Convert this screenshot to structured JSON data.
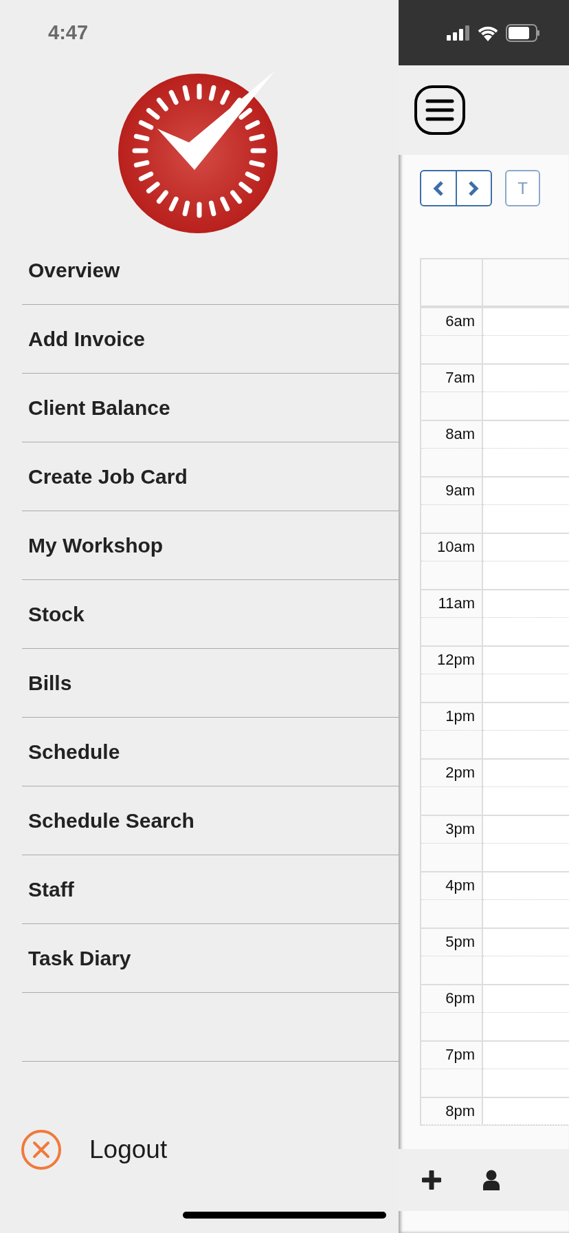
{
  "status_bar": {
    "time": "4:47"
  },
  "menu": {
    "items": [
      {
        "label": "Overview"
      },
      {
        "label": "Add Invoice"
      },
      {
        "label": "Client Balance"
      },
      {
        "label": "Create Job Card"
      },
      {
        "label": "My Workshop"
      },
      {
        "label": "Stock"
      },
      {
        "label": "Bills"
      },
      {
        "label": "Schedule"
      },
      {
        "label": "Schedule Search"
      },
      {
        "label": "Staff"
      },
      {
        "label": "Task Diary"
      }
    ]
  },
  "logout": {
    "label": "Logout"
  },
  "calendar": {
    "today_button": "T",
    "hours": [
      "6am",
      "7am",
      "8am",
      "9am",
      "10am",
      "11am",
      "12pm",
      "1pm",
      "2pm",
      "3pm",
      "4pm",
      "5pm",
      "6pm",
      "7pm",
      "8pm"
    ]
  }
}
